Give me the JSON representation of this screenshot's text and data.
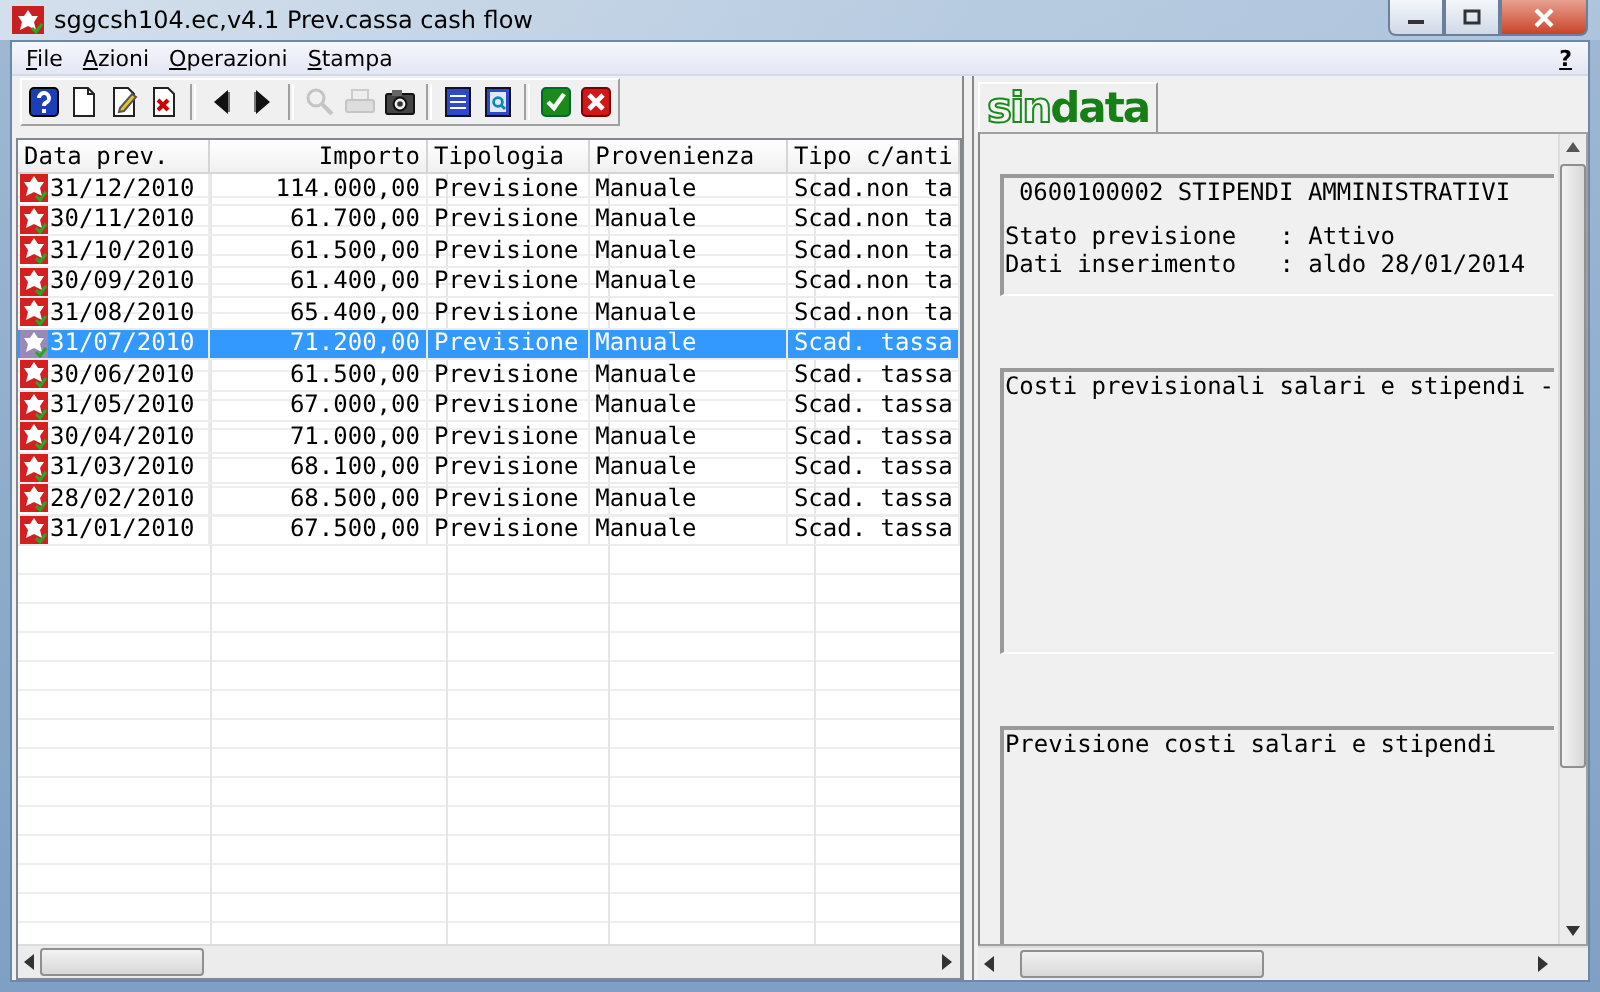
{
  "window": {
    "title": "sggcsh104.ec,v4.1 Prev.cassa cash flow"
  },
  "menu": [
    "File",
    "Azioni",
    "Operazioni",
    "Stampa"
  ],
  "help_menu": "?",
  "toolbar": [
    {
      "kind": "help",
      "disabled": false
    },
    {
      "kind": "new",
      "disabled": false
    },
    {
      "kind": "edit",
      "disabled": false
    },
    {
      "kind": "delete",
      "disabled": false
    },
    {
      "kind": "separator"
    },
    {
      "kind": "prev",
      "disabled": false
    },
    {
      "kind": "next",
      "disabled": false
    },
    {
      "kind": "separator"
    },
    {
      "kind": "search",
      "disabled": true
    },
    {
      "kind": "print",
      "disabled": true
    },
    {
      "kind": "camera",
      "disabled": false
    },
    {
      "kind": "separator"
    },
    {
      "kind": "list",
      "disabled": false
    },
    {
      "kind": "preview",
      "disabled": false
    },
    {
      "kind": "separator"
    },
    {
      "kind": "confirm",
      "disabled": false
    },
    {
      "kind": "cancel",
      "disabled": false
    }
  ],
  "logo": "sin**data**",
  "table": {
    "columns": [
      "Data prev.",
      "Importo",
      "Tipologia",
      "Provenienza",
      "Tipo c/anti"
    ],
    "rows": [
      {
        "cells": [
          "31/12/2010",
          "114.000,00",
          "Previsione",
          "Manuale",
          "Scad.non ta"
        ],
        "selected": false
      },
      {
        "cells": [
          "30/11/2010",
          "61.700,00",
          "Previsione",
          "Manuale",
          "Scad.non ta"
        ],
        "selected": false
      },
      {
        "cells": [
          "31/10/2010",
          "61.500,00",
          "Previsione",
          "Manuale",
          "Scad.non ta"
        ],
        "selected": false
      },
      {
        "cells": [
          "30/09/2010",
          "61.400,00",
          "Previsione",
          "Manuale",
          "Scad.non ta"
        ],
        "selected": false
      },
      {
        "cells": [
          "31/08/2010",
          "65.400,00",
          "Previsione",
          "Manuale",
          "Scad.non ta"
        ],
        "selected": false
      },
      {
        "cells": [
          "31/07/2010",
          "71.200,00",
          "Previsione",
          "Manuale",
          "Scad. tassa"
        ],
        "selected": true
      },
      {
        "cells": [
          "30/06/2010",
          "61.500,00",
          "Previsione",
          "Manuale",
          "Scad. tassa"
        ],
        "selected": false
      },
      {
        "cells": [
          "31/05/2010",
          "67.000,00",
          "Previsione",
          "Manuale",
          "Scad. tassa"
        ],
        "selected": false
      },
      {
        "cells": [
          "30/04/2010",
          "71.000,00",
          "Previsione",
          "Manuale",
          "Scad. tassa"
        ],
        "selected": false
      },
      {
        "cells": [
          "31/03/2010",
          "68.100,00",
          "Previsione",
          "Manuale",
          "Scad. tassa"
        ],
        "selected": false
      },
      {
        "cells": [
          "28/02/2010",
          "68.500,00",
          "Previsione",
          "Manuale",
          "Scad. tassa"
        ],
        "selected": false
      },
      {
        "cells": [
          "31/01/2010",
          "67.500,00",
          "Previsione",
          "Manuale",
          "Scad. tassa"
        ],
        "selected": false
      }
    ]
  },
  "detail": {
    "header": "0600100002 STIPENDI AMMINISTRATIVI",
    "lines": [
      "Stato previsione   : Attivo",
      "Dati inserimento   : aldo 28/01/2014"
    ],
    "note": "Costi previsionali salari e stipendi -",
    "description": "Previsione costi salari e stipendi"
  }
}
